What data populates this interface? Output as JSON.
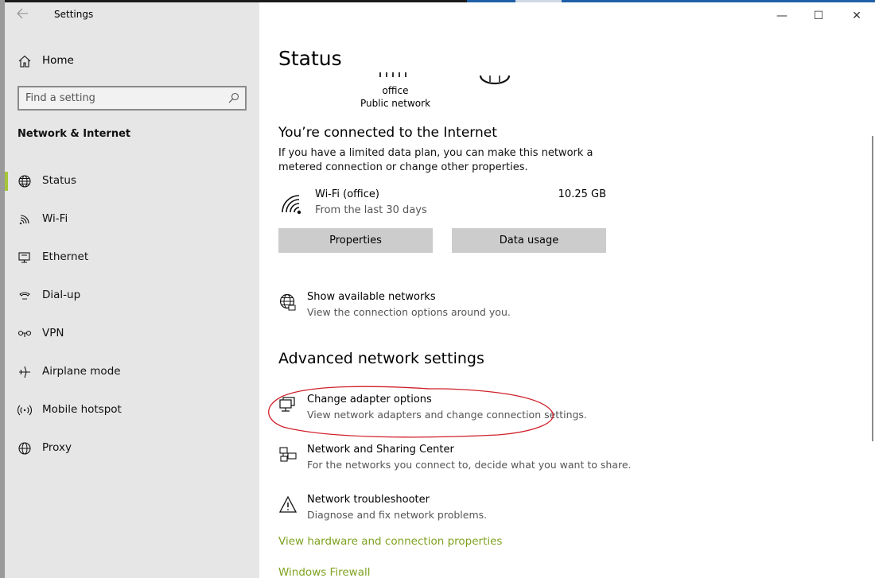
{
  "window": {
    "app_title": "Settings",
    "back_glyph": "←",
    "minimize_glyph": "—",
    "maximize_glyph": "☐",
    "close_glyph": "✕"
  },
  "sidebar": {
    "home_label": "Home",
    "search_placeholder": "Find a setting",
    "section_title": "Network & Internet",
    "items": [
      {
        "label": "Status",
        "icon": "globe-icon",
        "selected": true
      },
      {
        "label": "Wi-Fi",
        "icon": "wifi-icon"
      },
      {
        "label": "Ethernet",
        "icon": "ethernet-icon"
      },
      {
        "label": "Dial-up",
        "icon": "dialup-icon"
      },
      {
        "label": "VPN",
        "icon": "vpn-icon"
      },
      {
        "label": "Airplane mode",
        "icon": "airplane-icon"
      },
      {
        "label": "Mobile hotspot",
        "icon": "hotspot-icon"
      },
      {
        "label": "Proxy",
        "icon": "globe-icon"
      }
    ],
    "accent_color": "#a6c539"
  },
  "main": {
    "title": "Status",
    "network_name": "office",
    "network_type": "Public network",
    "connected_title": "You’re connected to the Internet",
    "connected_desc": "If you have a limited data plan, you can make this network a metered connection or change other properties.",
    "usage": {
      "name": "Wi-Fi (office)",
      "period": "From the last 30 days",
      "amount": "10.25 GB"
    },
    "properties_button": "Properties",
    "data_usage_button": "Data usage",
    "show_networks": {
      "title": "Show available networks",
      "desc": "View the connection options around you."
    },
    "advanced_title": "Advanced network settings",
    "adapter": {
      "title": "Change adapter options",
      "desc": "View network adapters and change connection settings."
    },
    "sharing": {
      "title": "Network and Sharing Center",
      "desc": "For the networks you connect to, decide what you want to share."
    },
    "troubleshooter": {
      "title": "Network troubleshooter",
      "desc": "Diagnose and fix network problems."
    },
    "hardware_link": "View hardware and connection properties",
    "firewall_link": "Windows Firewall",
    "link_color": "#7ea21f",
    "annotation_color": "#d0202a"
  }
}
